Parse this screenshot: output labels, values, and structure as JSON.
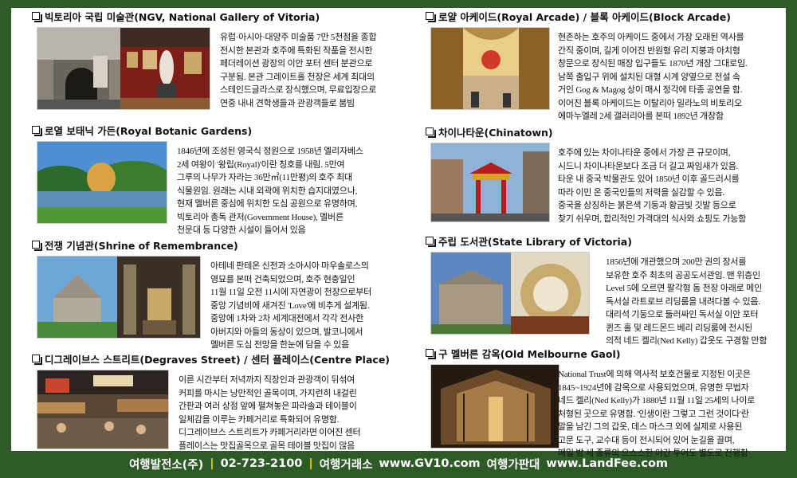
{
  "left": [
    {
      "title": "빅토리아 국립 미술관(NGV, National Gallery of Vitoria)",
      "image": "ngv-gallery-photo",
      "lines": [
        "유럽·아시아·대양주 미술품 7만 5천점을 종합",
        "전시한 본관과 호주에 특화된 작품을 전시한",
        "페더레이션 광장의 이안 포터 센터 분관으로",
        "구분됨. 본관 그레이트홀 천장은 세계 최대의",
        "스테인드글라스로 장식했으며, 무료입장으로",
        "연중 내내 견학생들과 관광객들로 붐빔"
      ]
    },
    {
      "title": "로열 보태닉 가든(Royal Botanic Gardens)",
      "image": "botanic-garden-photo",
      "lines": [
        "1846년에 조성된 영국식 정원으로 1958년 엘리자베스",
        "2세 여왕이 '왕립(Royal)'이란 칭호를 내림. 5만여",
        "그루의 나무가 자라는 36만㎡(11만평)의 호주 최대",
        "식물원임. 원래는 시내 외곽에 위치한 습지대였으나,",
        "현재 멜버른 중심에 위치한 도심 공원으로 유명하며,",
        "빅토리아 총독 관저(Government House), 멜버른",
        "천문대 등 다양한 시설이 들어서 있음"
      ]
    },
    {
      "title": "전쟁 기념관(Shrine of Remembrance)",
      "image": "shrine-photo",
      "lines": [
        "아테네 판테온 신전과 소아시아 마우솔로스의",
        "영묘를 본떠 건축되었으며, 호주 현충일인",
        "11월 11일 오전 11시에 자연광이 천장으로부터",
        "중앙 기념비에 새겨진 'Love'에 비추게 설계됨.",
        "중앙에 1차와 2차 세계대전에서 각각 전사한",
        "아버지와 아들의 동상이 있으며, 발코니에서",
        "멜버른 도심 전망을 한눈에 담을 수 있음"
      ]
    },
    {
      "title": "디그레이브스 스트리트(Degraves Street) / 센터 플레이스(Centre Place)",
      "image": "degraves-street-photo",
      "lines": [
        "이른 시간부터 저녁까지 직장인과 관광객이 뒤섞여",
        "커피를 마시는 낭만적인 골목이며, 가지런히 내걸린",
        "간판과 여러 상점 앞에 펼쳐놓은 파라솔과 테이블이",
        "일체감을 이루는 카페거리로 특화되어 유명함.",
        "디그레이브스 스트리트가 카페거리라면 이어진 센터",
        "플레이스는 맛집골목으로 골목 테이블 맛집이 많음"
      ]
    }
  ],
  "right": [
    {
      "title": "로얄 아케이드(Royal Arcade) / 블록 아케이드(Block Arcade)",
      "image": "royal-arcade-photo",
      "lines": [
        "현존하는 호주의 아케이드 중에서 가장 오래된 역사를",
        "간직 중이며, 길게 이어진 반원형 유리 지붕과 아치형",
        "창문으로 장식된 매장 입구들도 1870년 개장 그대로임.",
        "남쪽 출입구 위에 설치된 대형 시계 양옆으로 전설 속",
        "거인 Gog & Magog 상이 매시 정각에 타종 공연을 함.",
        "이어진 블록 아케이드는 이탈리아 밀라노의 비토리오",
        "에마누엘레 2세 갤러리아를 본떠 1892년 개장함"
      ]
    },
    {
      "title": "차이나타운(Chinatown)",
      "image": "chinatown-photo",
      "lines": [
        "호주에 있는 차이나타운 중에서 가장 큰 규모이며,",
        "시드니 차이나타운보다 조금 더 길고 짜임새가 있음.",
        "타운 내 중국 박물관도 있어 1850년 이후 골드러시를",
        "따라 이민 온 중국인들의 저력을 실감할 수 있음.",
        "중국을 상징하는 붉은색 기둥과 황금빛 깃발 등으로",
        "찾기 쉬우며, 합리적인 가격대의 식사와 쇼핑도 가능함"
      ]
    },
    {
      "title": "주립 도서관(State Library of Victoria)",
      "image": "state-library-photo",
      "lines": [
        "1856년에 개관했으며 200만 권의 장서를",
        "보유한 호주 최초의 공공도서관임. 맨 위층인",
        "Level 5에 오르면 팔각형 돔 천장 아래로 메인",
        "독서실 라트로브 리딩룸을 내려다볼 수 있음.",
        "대리석 기둥으로 둘러싸인 독서실 이안 포터",
        "퀸즈 홀 및 레드몬드 베리 리딩룸에 전시된",
        "의적 네드 켈리(Ned Kelly) 갑옷도 구경할 만함"
      ]
    },
    {
      "title": "구 멜버른 감옥(Old Melbourne Gaol)",
      "image": "old-gaol-photo",
      "lines": [
        "National Trust에 의해 역사적 보호건물로 지정된 이곳은",
        "1845~1924년에 감옥으로 사용되었으며, 유명한 무법자",
        "네드 켈리(Ned Kelly)가 1880년 11월 11일 25세의 나이로",
        "처형된 곳으로 유명함. '인생이란 그렇고 그런 것이다'란",
        "말을 남긴 그의 갑옷, 데스 마스크 외에 실제로 사용된",
        "고문 도구, 교수대 등이 전시되어 있어 눈길을 끌며,",
        "매일 밤 세 종류의 으스스한 야간 투어도 별도로 진행함"
      ]
    }
  ],
  "footer": {
    "company": "여행발전소(주)",
    "phone": "02-723-2100",
    "market": "여행거래소",
    "url1": "www.GV10.com",
    "board": "여행가판대",
    "url2": "www.LandFee.com",
    "separator": "|"
  },
  "colors": {
    "frame": "#2d5a27",
    "separator": "#f3d000"
  }
}
